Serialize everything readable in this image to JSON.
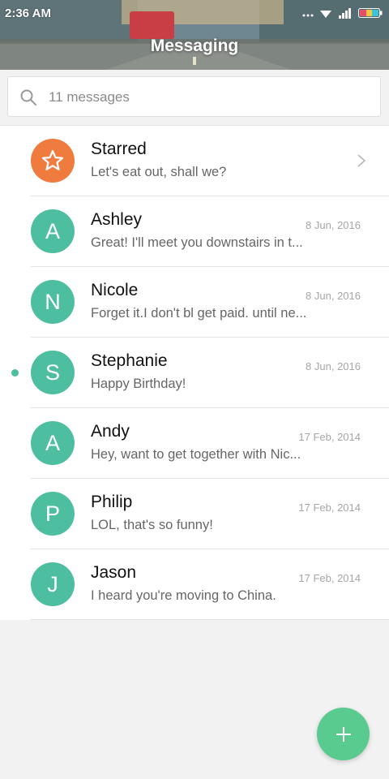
{
  "status": {
    "time": "2:36 AM"
  },
  "header": {
    "title": "Messaging"
  },
  "search": {
    "text": "11 messages"
  },
  "colors": {
    "accent": "#4dbfa0",
    "starred": "#f07b3f",
    "fab": "#5acb8f"
  },
  "starred": {
    "name": "Starred",
    "preview": "Let's eat out, shall we?",
    "icon": "star-icon"
  },
  "conversations": [
    {
      "initial": "A",
      "name": "Ashley",
      "preview": "Great! I'll meet you downstairs in t...",
      "date": "8 Jun, 2016",
      "unread": false
    },
    {
      "initial": "N",
      "name": "Nicole",
      "preview": "Forget it.I don't bl get paid. until ne...",
      "date": "8 Jun, 2016",
      "unread": false
    },
    {
      "initial": "S",
      "name": "Stephanie",
      "preview": "Happy Birthday!",
      "date": "8 Jun, 2016",
      "unread": true
    },
    {
      "initial": "A",
      "name": "Andy",
      "preview": "Hey, want to get together with Nic...",
      "date": "17 Feb, 2014",
      "unread": false
    },
    {
      "initial": "P",
      "name": "Philip",
      "preview": "LOL, that's so funny!",
      "date": "17 Feb, 2014",
      "unread": false
    },
    {
      "initial": "J",
      "name": "Jason",
      "preview": "I heard you're moving to China.",
      "date": "17 Feb, 2014",
      "unread": false
    }
  ],
  "fab": {
    "icon": "plus-icon"
  }
}
